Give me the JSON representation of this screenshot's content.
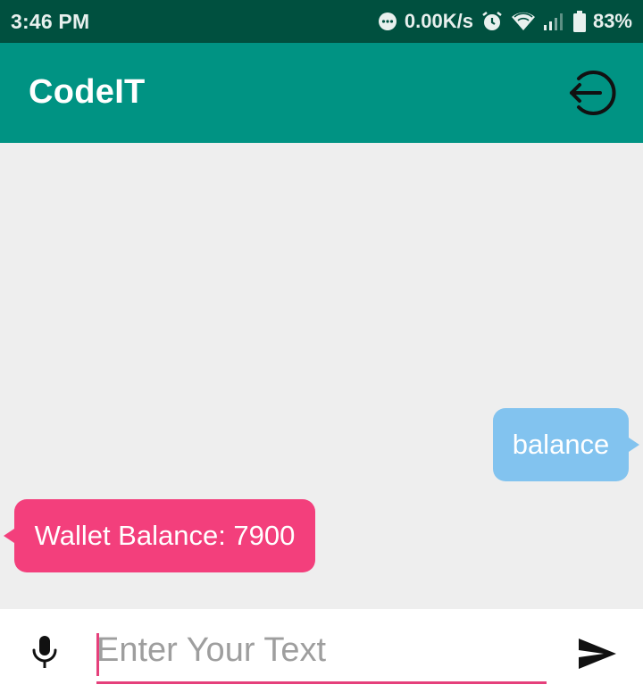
{
  "status_bar": {
    "time": "3:46 PM",
    "net_speed": "0.00K/s",
    "battery": "83%",
    "icons": [
      "more-icon",
      "alarm-icon",
      "wifi-icon",
      "signal-icon",
      "battery-icon"
    ]
  },
  "app_bar": {
    "title": "CodeIT",
    "logout_icon": "logout-icon",
    "color": "#009383"
  },
  "messages": [
    {
      "text": "balance",
      "sender": "user",
      "color": "#82c3ef"
    },
    {
      "text": "Wallet Balance: 7900",
      "sender": "bot",
      "color": "#f33f7c"
    }
  ],
  "input_bar": {
    "placeholder": "Enter Your Text",
    "value": "",
    "mic_icon": "microphone-icon",
    "send_icon": "send-icon",
    "accent": "#e5407b"
  }
}
